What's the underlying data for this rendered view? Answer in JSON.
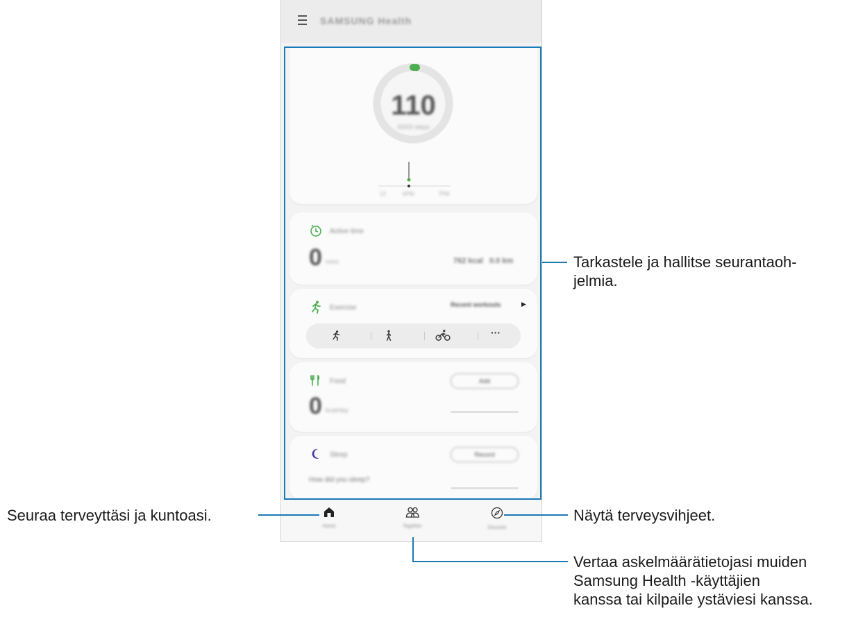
{
  "app": {
    "title": "SAMSUNG Health"
  },
  "steps": {
    "value": "110",
    "unit": "/6000 steps",
    "graph_labels": [
      "12",
      "6PM",
      "7PM"
    ]
  },
  "active_time": {
    "title": "Active time",
    "value": "0",
    "unit": "mins",
    "kcal": "762 kcal",
    "km": "0.0 km"
  },
  "exercise": {
    "title": "Exercise",
    "recent_label": "Recent workouts",
    "shortcuts": [
      "run-icon",
      "walk-icon",
      "bike-icon",
      "more-icon"
    ]
  },
  "food": {
    "title": "Food",
    "value": "0",
    "unit": "kcal/day",
    "button": "Add"
  },
  "sleep": {
    "title": "Sleep",
    "button": "Record",
    "question": "How did you sleep?"
  },
  "bottom_nav": [
    {
      "label": "Home",
      "icon": "home-icon"
    },
    {
      "label": "Together",
      "icon": "people-icon"
    },
    {
      "label": "Discover",
      "icon": "compass-icon"
    }
  ],
  "callouts": {
    "trackers": "Tarkastele ja hallitse seurantaoh-\njelmia.",
    "home": "Seuraa terveyttäsi ja kuntoasi.",
    "discover": "Näytä terveysvihjeet.",
    "together": "Vertaa askelmäärätietojasi muiden\nSamsung Health -käyttäjien\nkanssa tai kilpaile ystäviesi kanssa."
  },
  "colors": {
    "accent_line": "#1a79b7",
    "progress_green": "#4caf50",
    "sleep_moon": "#3f3aa3"
  }
}
